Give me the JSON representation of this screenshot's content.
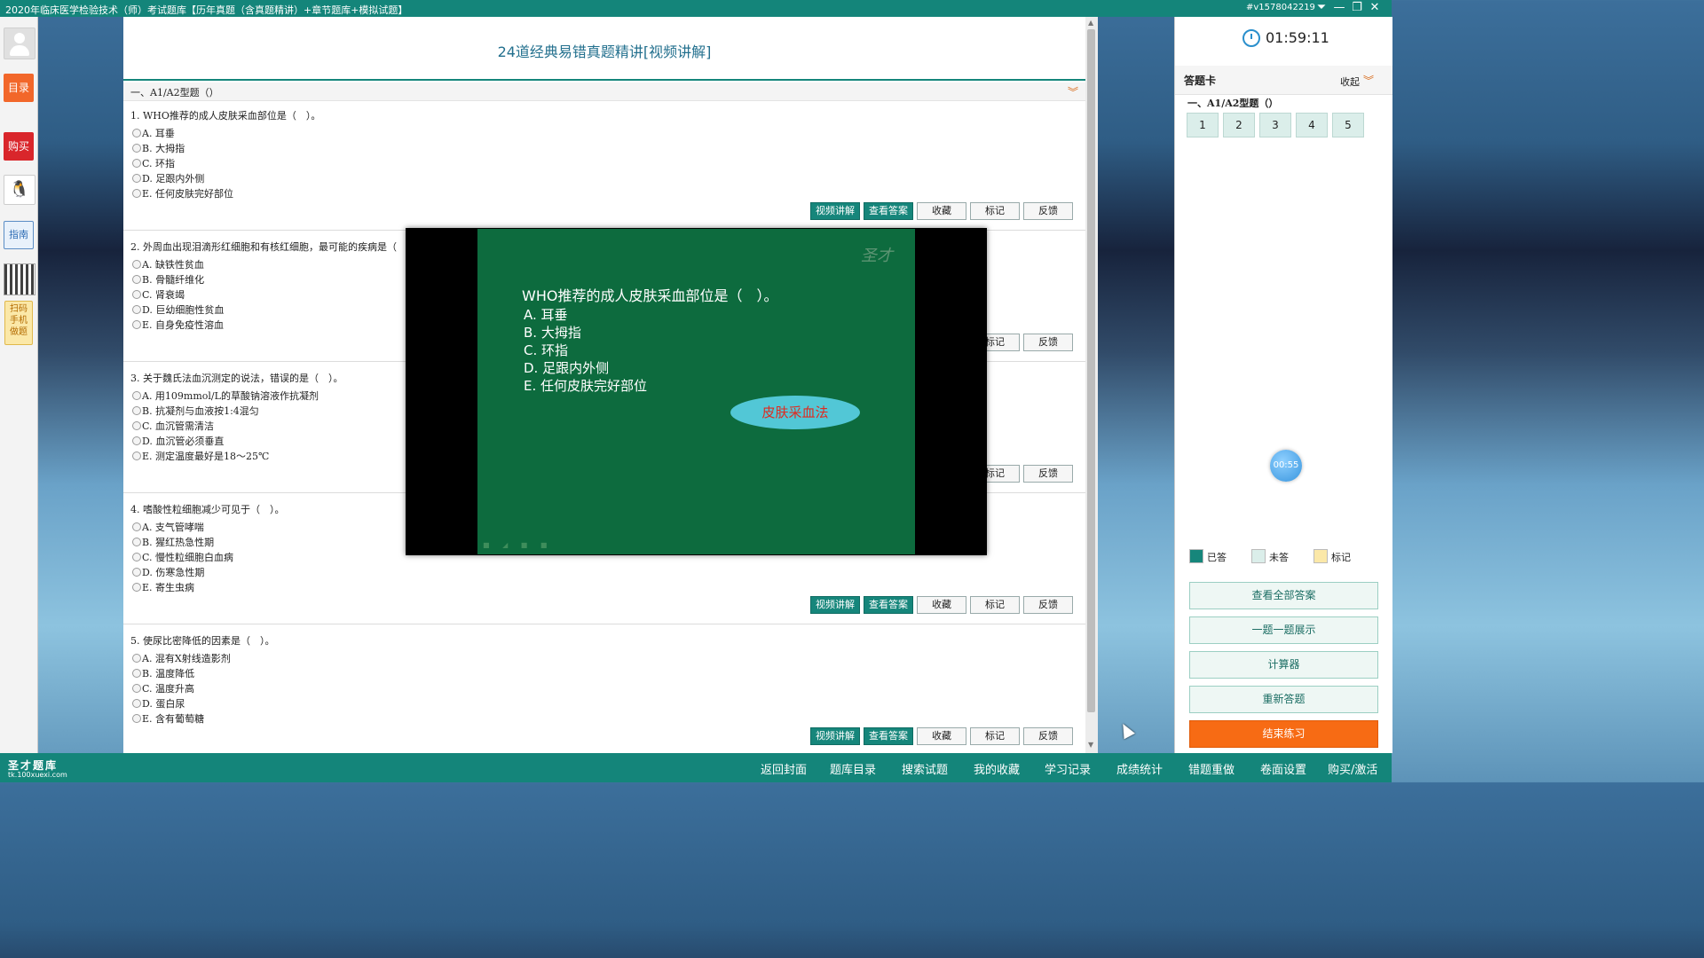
{
  "window": {
    "title": "2020年临床医学检验技术（师）考试题库【历年真题（含真题精讲）+章节题库+模拟试题】",
    "user_id": "#v1578042219",
    "controls": [
      "⏷",
      "—",
      "❐",
      "✕"
    ]
  },
  "leftbar": {
    "catalog": "目录",
    "buy": "购买",
    "guide": "指南",
    "scan": [
      "扫码",
      "手机",
      "做题"
    ],
    "colors": {
      "catalog": "#f2672a",
      "buy": "#d9262b"
    }
  },
  "main": {
    "page_title": "24道经典易错真题精讲[视频讲解]",
    "section": "一、A1/A2型题（）",
    "button_labels": {
      "video": "视频讲解",
      "answer": "查看答案",
      "favorite": "收藏",
      "mark": "标记",
      "feedback": "反馈"
    },
    "questions": [
      {
        "text": "1. WHO推荐的成人皮肤采血部位是（　）。",
        "options": [
          "A. 耳垂",
          "B. 大拇指",
          "C. 环指",
          "D. 足跟内外侧",
          "E. 任何皮肤完好部位"
        ]
      },
      {
        "text": "2. 外周血出现泪滴形红细胞和有核红细胞，最可能的疾病是（",
        "options": [
          "A. 缺铁性贫血",
          "B. 骨髓纤维化",
          "C. 肾衰竭",
          "D. 巨幼细胞性贫血",
          "E. 自身免疫性溶血"
        ]
      },
      {
        "text": "3. 关于魏氏法血沉测定的说法，错误的是（　）。",
        "options": [
          "A. 用109mmol/L的草酸钠溶液作抗凝剂",
          "B. 抗凝剂与血液按1:4混匀",
          "C. 血沉管需清洁",
          "D. 血沉管必须垂直",
          "E. 测定温度最好是18～25℃"
        ]
      },
      {
        "text": "4. 嗜酸性粒细胞减少可见于（　）。",
        "options": [
          "A. 支气管哮喘",
          "B. 猩红热急性期",
          "C. 慢性粒细胞白血病",
          "D. 伤寒急性期",
          "E. 寄生虫病"
        ]
      },
      {
        "text": "5. 使尿比密降低的因素是（　）。",
        "options": [
          "A. 混有X射线造影剂",
          "B. 温度降低",
          "C. 温度升高",
          "D. 蛋白尿",
          "E. 含有葡萄糖"
        ]
      }
    ]
  },
  "video": {
    "logo": "圣才",
    "question": "WHO推荐的成人皮肤采血部位是（　）。",
    "options": [
      "A.  耳垂",
      "B.  大拇指",
      "C.  环指",
      "D.  足跟内外侧",
      "E.  任何皮肤完好部位"
    ],
    "badge": "皮肤采血法"
  },
  "right": {
    "timer": "01:59:11",
    "card_title": "答题卡",
    "collapse": "收起",
    "section": "一、A1/A2型题（）",
    "numbers": [
      "1",
      "2",
      "3",
      "4",
      "5"
    ],
    "float_timer": "00:55",
    "legend": [
      {
        "label": "已答",
        "color": "#16867b"
      },
      {
        "label": "未答",
        "color": "#dbeeea"
      },
      {
        "label": "标记",
        "color": "#fbe8a8"
      }
    ],
    "buttons": [
      "查看全部答案",
      "一题一题展示",
      "计算器",
      "重新答题",
      "结束练习"
    ]
  },
  "bottombar": {
    "brand": "圣才题库",
    "url": "tk.100xuexi.com",
    "nav": [
      "返回封面",
      "题库目录",
      "搜索试题",
      "我的收藏",
      "学习记录",
      "成绩统计",
      "错题重做",
      "卷面设置",
      "购买/激活"
    ]
  }
}
